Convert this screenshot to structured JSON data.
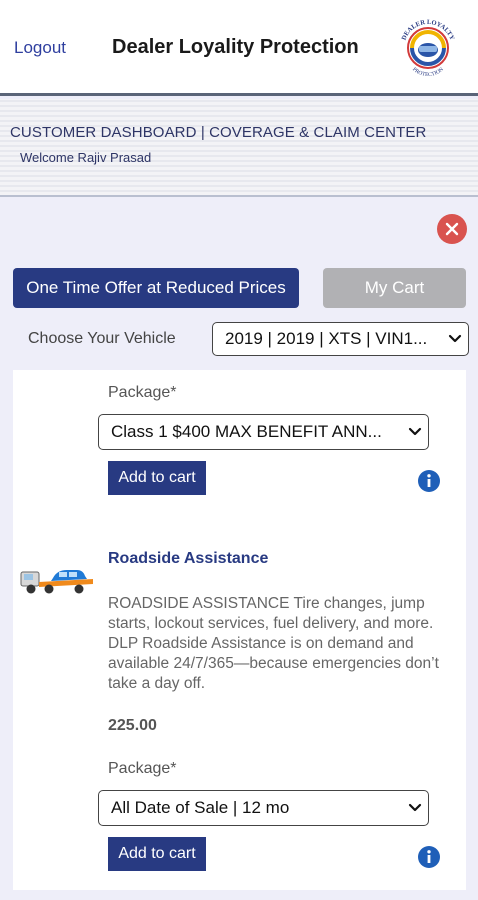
{
  "header": {
    "logout_label": "Logout",
    "title": "Dealer Loyality Protection",
    "logo_text_top": "DEALER LOYALTY",
    "logo_text_bottom": "PROTECTION"
  },
  "banner": {
    "title": "CUSTOMER DASHBOARD | COVERAGE & CLAIM CENTER",
    "welcome": "Welcome Rajiv Prasad"
  },
  "actions": {
    "offer_label": "One Time Offer at Reduced Prices",
    "cart_label": "My Cart"
  },
  "vehicle": {
    "label": "Choose Your Vehicle",
    "selected": "2019 | 2019 | XTS | VIN1..."
  },
  "products": [
    {
      "package_label": "Package*",
      "package_selected": "Class 1 $400 MAX BENEFIT ANN...",
      "add_label": "Add to cart"
    },
    {
      "name": "Roadside Assistance",
      "description": "ROADSIDE ASSISTANCE Tire changes, jump starts, lockout services, fuel delivery, and more. DLP Roadside Assistance is on demand and available 24/7/365—because emergencies don’t take a day off.",
      "price": "225.00",
      "package_label": "Package*",
      "package_selected": "All Date of Sale | 12 mo",
      "add_label": "Add to cart"
    }
  ],
  "colors": {
    "primary": "#283a82",
    "close": "#d9534f",
    "info": "#1f5fb8",
    "background": "#eeeef9"
  },
  "icons": [
    "close-icon",
    "info-icon",
    "chevron-down-icon",
    "tow-truck-icon",
    "logo"
  ]
}
